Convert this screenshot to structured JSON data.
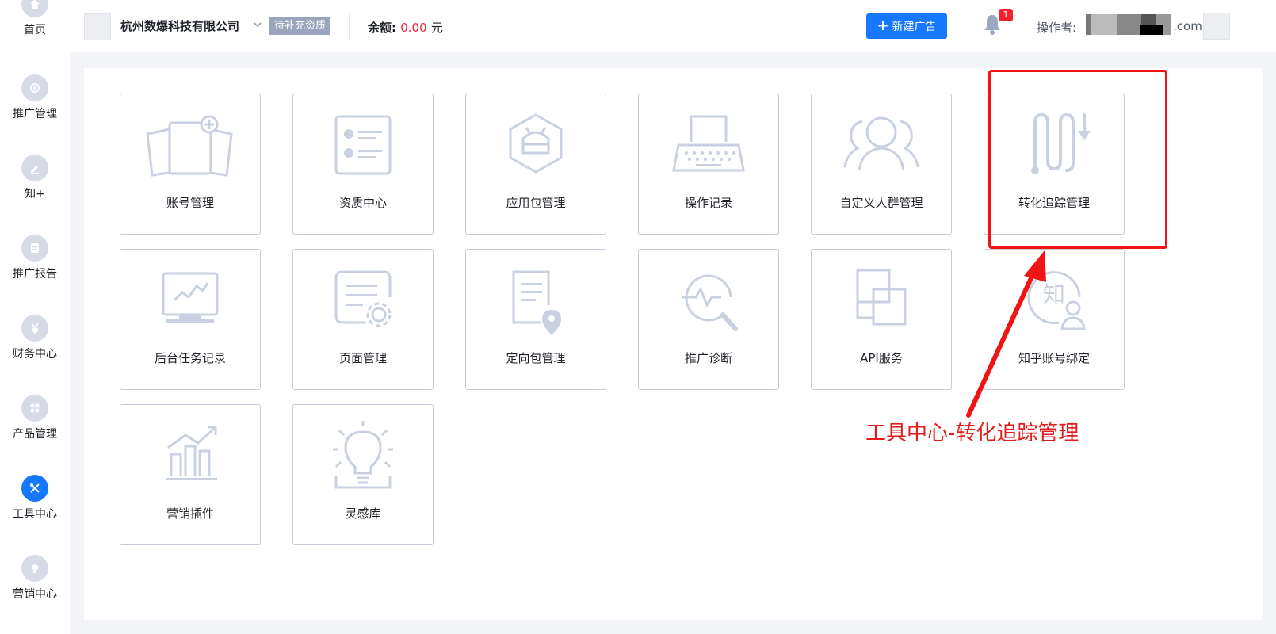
{
  "sidebar": {
    "items": [
      {
        "label": "首页",
        "icon": "home-icon"
      },
      {
        "label": "推广管理",
        "icon": "promotion-icon"
      },
      {
        "label": "知+",
        "icon": "edit-icon"
      },
      {
        "label": "推广报告",
        "icon": "report-icon"
      },
      {
        "label": "财务中心",
        "icon": "yuan-icon"
      },
      {
        "label": "产品管理",
        "icon": "grid-icon"
      },
      {
        "label": "工具中心",
        "icon": "tools-icon",
        "active": true
      },
      {
        "label": "营销中心",
        "icon": "marketing-icon"
      }
    ]
  },
  "header": {
    "company": "杭州数爆科技有限公司",
    "qualification_badge": "待补充资质",
    "balance_label": "余额:",
    "balance_value": "0.00",
    "balance_unit": "元",
    "new_ad_label": "新建广告",
    "notification_count": "1",
    "operator_label": "操作者:",
    "operator_domain": ".com"
  },
  "tools": [
    {
      "label": "账号管理",
      "icon": "account-cards-icon"
    },
    {
      "label": "资质中心",
      "icon": "qualification-list-icon"
    },
    {
      "label": "应用包管理",
      "icon": "android-package-icon"
    },
    {
      "label": "操作记录",
      "icon": "typewriter-icon"
    },
    {
      "label": "自定义人群管理",
      "icon": "people-group-icon"
    },
    {
      "label": "转化追踪管理",
      "icon": "conversion-tracking-icon"
    },
    {
      "label": "后台任务记录",
      "icon": "monitor-chart-icon"
    },
    {
      "label": "页面管理",
      "icon": "page-settings-icon"
    },
    {
      "label": "定向包管理",
      "icon": "document-location-icon"
    },
    {
      "label": "推广诊断",
      "icon": "diagnosis-icon"
    },
    {
      "label": "API服务",
      "icon": "api-squares-icon"
    },
    {
      "label": "知乎账号绑定",
      "icon": "zhihu-bind-icon"
    },
    {
      "label": "营销插件",
      "icon": "growth-chart-icon"
    },
    {
      "label": "灵感库",
      "icon": "lightbulb-icon"
    }
  ],
  "annotation": {
    "text": "工具中心-转化追踪管理",
    "color": "#e51a1a"
  },
  "colors": {
    "accent": "#1677ff",
    "danger": "#f5222d",
    "icon_stroke": "#c9d1e1"
  }
}
